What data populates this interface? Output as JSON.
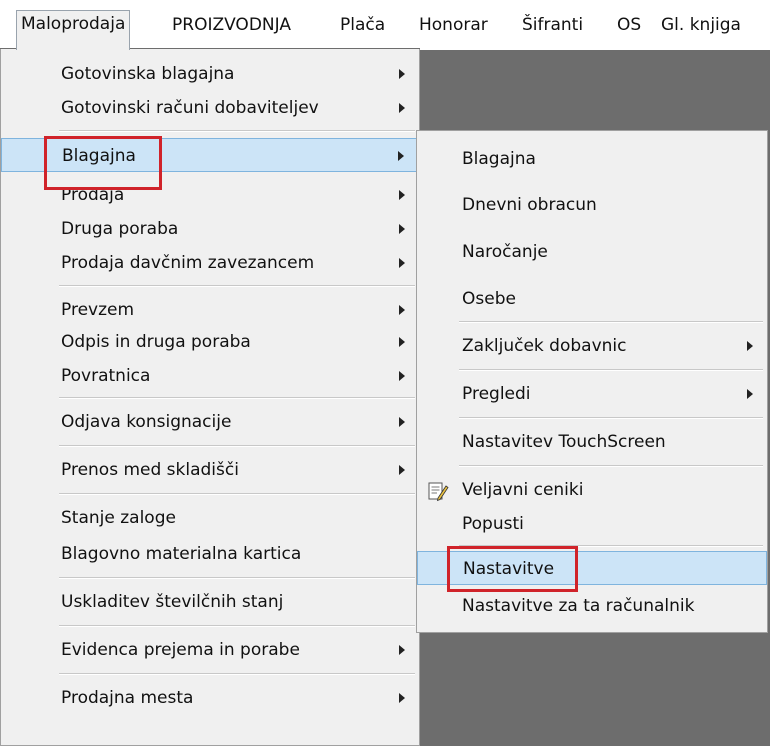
{
  "menubar": {
    "items": [
      {
        "label": "Maloprodaja"
      },
      {
        "label": "PROIZVODNJA"
      },
      {
        "label": "Plača"
      },
      {
        "label": "Honorar"
      },
      {
        "label": "Šifranti"
      },
      {
        "label": "OS"
      },
      {
        "label": "Gl. knjiga"
      }
    ]
  },
  "main_menu": {
    "items": [
      {
        "label": "Gotovinska blagajna",
        "submenu": true
      },
      {
        "label": "Gotovinski računi dobaviteljev",
        "submenu": true
      },
      {
        "label": "Blagajna",
        "submenu": true,
        "highlighted": true
      },
      {
        "label": "Prodaja",
        "submenu": true
      },
      {
        "label": "Druga poraba",
        "submenu": true
      },
      {
        "label": "Prodaja davčnim zavezancem",
        "submenu": true
      },
      {
        "label": "Prevzem",
        "submenu": true
      },
      {
        "label": "Odpis in druga poraba",
        "submenu": true
      },
      {
        "label": "Povratnica",
        "submenu": true
      },
      {
        "label": "Odjava konsignacije",
        "submenu": true
      },
      {
        "label": "Prenos med skladišči",
        "submenu": true
      },
      {
        "label": "Stanje zaloge",
        "submenu": false
      },
      {
        "label": "Blagovno materialna kartica",
        "submenu": false
      },
      {
        "label": "Uskladitev številčnih stanj",
        "submenu": false
      },
      {
        "label": "Evidenca prejema in porabe",
        "submenu": true
      },
      {
        "label": "Prodajna mesta",
        "submenu": true
      }
    ]
  },
  "sub_menu": {
    "items": [
      {
        "label": "Blagajna",
        "submenu": false
      },
      {
        "label": "Dnevni obracun",
        "submenu": false
      },
      {
        "label": "Naročanje",
        "submenu": false
      },
      {
        "label": "Osebe",
        "submenu": false
      },
      {
        "label": "Zaključek dobavnic",
        "submenu": true
      },
      {
        "label": "Pregledi",
        "submenu": true
      },
      {
        "label": "Nastavitev TouchScreen",
        "submenu": false
      },
      {
        "label": "Veljavni ceniki",
        "submenu": false,
        "icon": "edit-document-icon"
      },
      {
        "label": "Popusti",
        "submenu": false
      },
      {
        "label": "Nastavitve",
        "submenu": false,
        "highlighted": true
      },
      {
        "label": "Nastavitve za ta računalnik",
        "submenu": false
      }
    ]
  },
  "colors": {
    "highlight_fill": "#cce4f7",
    "highlight_border": "#7fb4de",
    "annotation_red": "#d0232a",
    "workspace": "#6d6d6d"
  }
}
